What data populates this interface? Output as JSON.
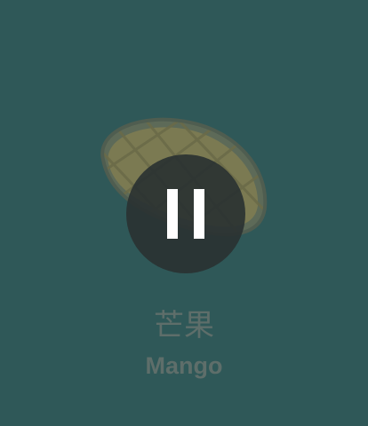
{
  "card": {
    "background_color": "#2f5858",
    "image_icon": "mango-icon",
    "playback_state": "paused",
    "pause_icon": "pause-icon",
    "label_zh": "芒果",
    "label_en": "Mango",
    "text_color": "#5e6e6a"
  }
}
